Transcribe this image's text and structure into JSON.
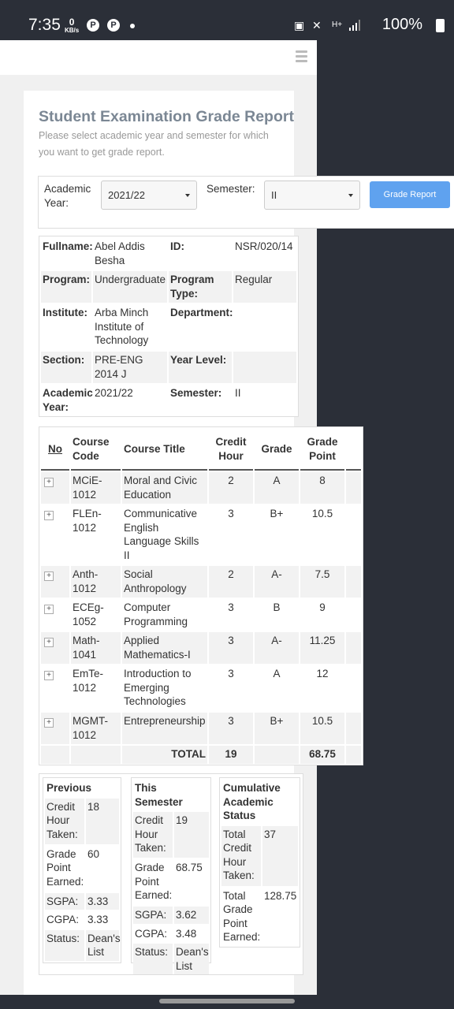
{
  "status_bar": {
    "time": "7:35",
    "net_speed_value": "0",
    "net_speed_unit": "KB/s",
    "battery": "100%",
    "icons": [
      "pinterest-icon",
      "pinterest-icon",
      "dot-icon",
      "battery-saver-icon",
      "mute-icon",
      "signal-hplus-icon",
      "signal-icon",
      "battery-icon"
    ]
  },
  "report": {
    "title": "Student Examination Grade Report",
    "subtitle": "Please select academic year and semester for which you want to get grade report."
  },
  "form": {
    "academic_year_label": "Academic Year:",
    "academic_year_value": "2021/22",
    "semester_label": "Semester:",
    "semester_value": "II",
    "button_label": "Grade Report"
  },
  "student": {
    "fullname_label": "Fullname:",
    "fullname": "Abel Addis Besha",
    "id_label": "ID:",
    "id": "NSR/020/14",
    "program_label": "Program:",
    "program": "Undergraduate",
    "program_type_label": "Program Type:",
    "program_type": "Regular",
    "institute_label": "Institute:",
    "institute": "Arba Minch Institute of Technology",
    "department_label": "Department:",
    "department": "",
    "section_label": "Section:",
    "section": "PRE-ENG 2014 J",
    "year_level_label": "Year Level:",
    "year_level": "",
    "academic_year_label": "Academic Year:",
    "academic_year": "2021/22",
    "semester_label": "Semester:",
    "semester": "II"
  },
  "courses": {
    "headers": {
      "no": "No",
      "code": "Course Code",
      "title": "Course Title",
      "credit": "Credit Hour",
      "grade": "Grade",
      "point": "Grade Point"
    },
    "rows": [
      {
        "code": "MCiE-1012",
        "title": "Moral and Civic Education",
        "credit": "2",
        "grade": "A",
        "point": "8"
      },
      {
        "code": "FLEn-1012",
        "title": "Communicative English Language Skills II",
        "credit": "3",
        "grade": "B+",
        "point": "10.5"
      },
      {
        "code": "Anth-1012",
        "title": "Social Anthropology",
        "credit": "2",
        "grade": "A-",
        "point": "7.5"
      },
      {
        "code": "ECEg-1052",
        "title": "Computer Programming",
        "credit": "3",
        "grade": "B",
        "point": "9"
      },
      {
        "code": "Math-1041",
        "title": "Applied Mathematics-I",
        "credit": "3",
        "grade": "A-",
        "point": "11.25"
      },
      {
        "code": "EmTe-1012",
        "title": "Introduction to Emerging Technologies",
        "credit": "3",
        "grade": "A",
        "point": "12"
      },
      {
        "code": "MGMT-1012",
        "title": "Entrepreneurship",
        "credit": "3",
        "grade": "B+",
        "point": "10.5"
      }
    ],
    "total_label": "TOTAL",
    "total_credit": "19",
    "total_point": "68.75"
  },
  "summary": {
    "previous": {
      "heading": "Previous",
      "credit_label": "Credit Hour Taken:",
      "credit": "18",
      "point_label": "Grade Point Earned:",
      "point": "60",
      "sgpa_label": "SGPA:",
      "sgpa": "3.33",
      "cgpa_label": "CGPA:",
      "cgpa": "3.33",
      "status_label": "Status:",
      "status": "Dean's List"
    },
    "this_semester": {
      "heading": "This Semester",
      "credit_label": "Credit Hour Taken:",
      "credit": "19",
      "point_label": "Grade Point Earned:",
      "point": "68.75",
      "sgpa_label": "SGPA:",
      "sgpa": "3.62",
      "cgpa_label": "CGPA:",
      "cgpa": "3.48",
      "status_label": "Status:",
      "status": "Dean's List"
    },
    "cumulative": {
      "heading": "Cumulative Academic Status",
      "credit_label": "Total Credit Hour Taken:",
      "credit": "37",
      "point_label": "Total Grade Point Earned:",
      "point": "128.75"
    }
  },
  "colors": {
    "button": "#5fa2ef",
    "status_green": "#1a8c2e",
    "title_gray": "#7b8794",
    "system_bar": "#2b2f38"
  }
}
